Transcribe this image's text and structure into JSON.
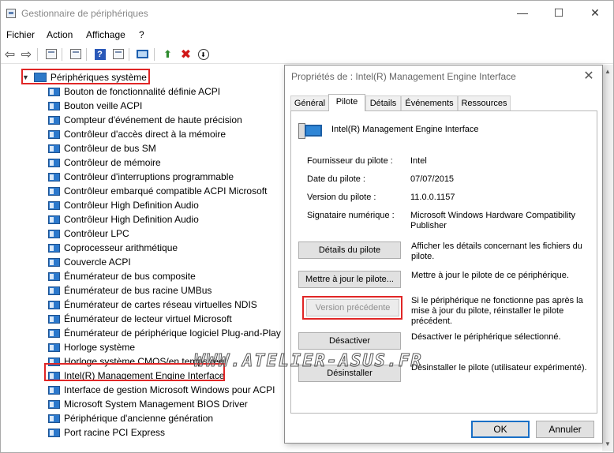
{
  "window": {
    "title": "Gestionnaire de périphériques",
    "controls": {
      "minimize": "—",
      "maximize": "☐",
      "close": "✕"
    }
  },
  "menubar": {
    "file": "Fichier",
    "action": "Action",
    "view": "Affichage",
    "help": "?"
  },
  "toolbar": {
    "icons": [
      "back-arrow-icon",
      "forward-arrow-icon",
      "properties-icon",
      "view-icon",
      "help-icon",
      "list-icon",
      "scan-hardware-icon",
      "update-driver-icon",
      "uninstall-icon",
      "disable-icon"
    ],
    "help_glyph": "?",
    "back_glyph": "⇦",
    "forward_glyph": "⇨",
    "update_glyph": "⬆",
    "uninstall_glyph": "✖",
    "disable_glyph": "⬇"
  },
  "tree": {
    "root": "Périphériques système",
    "items": [
      "Bouton de fonctionnalité définie ACPI",
      "Bouton veille ACPI",
      "Compteur d'événement de haute précision",
      "Contrôleur d'accès direct à la mémoire",
      "Contrôleur de bus SM",
      "Contrôleur de mémoire",
      "Contrôleur d'interruptions programmable",
      "Contrôleur embarqué compatible ACPI Microsoft",
      "Contrôleur High Definition Audio",
      "Contrôleur High Definition Audio",
      "Contrôleur LPC",
      "Coprocesseur arithmétique",
      "Couvercle ACPI",
      "Énumérateur de bus composite",
      "Énumérateur de bus racine UMBus",
      "Énumérateur de cartes réseau virtuelles NDIS",
      "Énumérateur de lecteur virtuel Microsoft",
      "Énumérateur de périphérique logiciel Plug-and-Play",
      "Horloge système",
      "Horloge système CMOS/en temps réel",
      "Intel(R) Management Engine Interface",
      "Interface de gestion Microsoft Windows pour ACPI",
      "Microsoft System Management BIOS Driver",
      "Périphérique d'ancienne génération",
      "Port racine PCI Express"
    ]
  },
  "dialog": {
    "title": "Propriétés de : Intel(R) Management Engine Interface",
    "close": "✕",
    "tabs": [
      "Général",
      "Pilote",
      "Détails",
      "Événements",
      "Ressources"
    ],
    "active_tab": "Pilote",
    "device_name": "Intel(R) Management Engine Interface",
    "props": [
      {
        "label": "Fournisseur du pilote :",
        "value": "Intel"
      },
      {
        "label": "Date du pilote :",
        "value": "07/07/2015"
      },
      {
        "label": "Version du pilote :",
        "value": "11.0.0.1157"
      },
      {
        "label": "Signataire numérique :",
        "value": "Microsoft Windows Hardware Compatibility Publisher"
      }
    ],
    "buttons": [
      {
        "label": "Détails du pilote",
        "desc": "Afficher les détails concernant les fichiers du pilote."
      },
      {
        "label": "Mettre à jour le pilote...",
        "desc": "Mettre à jour le pilote de ce périphérique."
      },
      {
        "label": "Version précédente",
        "desc": "Si le périphérique ne fonctionne pas après la mise à jour du pilote, réinstaller le pilote précédent."
      },
      {
        "label": "Désactiver",
        "desc": "Désactiver le périphérique sélectionné."
      },
      {
        "label": "Désinstaller",
        "desc": "Désinstaller le pilote (utilisateur expérimenté)."
      }
    ],
    "ok": "OK",
    "cancel": "Annuler"
  },
  "watermark": "WWW.ATELIER-ASUS.FR",
  "colors": {
    "highlight": "#e02626",
    "accent": "#1a6fc6"
  }
}
